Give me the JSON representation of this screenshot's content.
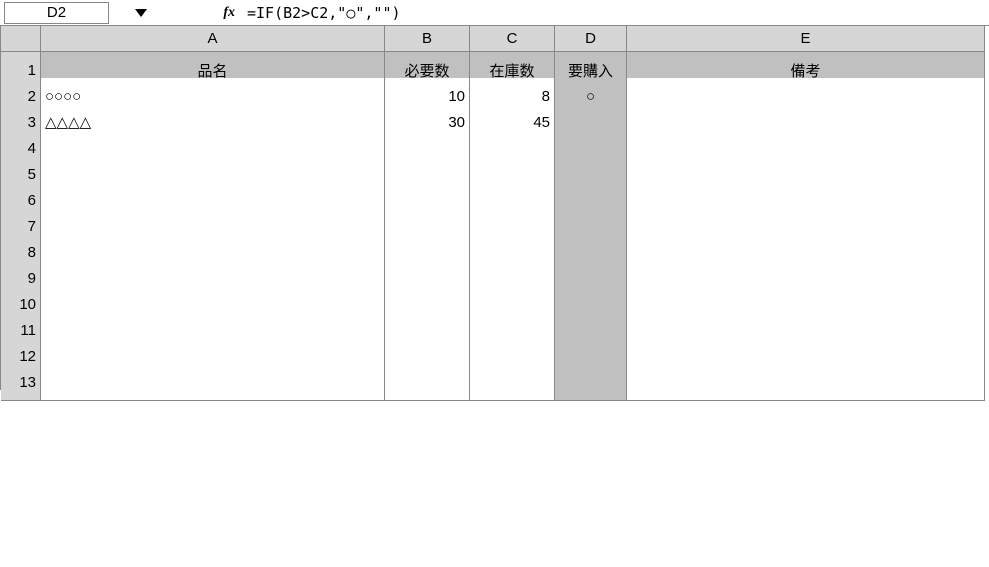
{
  "name_box": "D2",
  "fx_label": "fx",
  "formula": "=IF(B2>C2,\"○\",\"\")",
  "columns": [
    "A",
    "B",
    "C",
    "D",
    "E"
  ],
  "rows": [
    "1",
    "2",
    "3",
    "4",
    "5",
    "6",
    "7",
    "8",
    "9",
    "10",
    "11",
    "12",
    "13"
  ],
  "headers": {
    "A": "品名",
    "B": "必要数",
    "C": "在庫数",
    "D": "要購入",
    "E": "備考"
  },
  "data": [
    {
      "A": "○○○○",
      "B": "10",
      "C": "8",
      "D": "○",
      "E": ""
    },
    {
      "A": "△△△△",
      "B": "30",
      "C": "45",
      "D": "",
      "E": ""
    },
    {
      "A": "",
      "B": "",
      "C": "",
      "D": "",
      "E": ""
    },
    {
      "A": "",
      "B": "",
      "C": "",
      "D": "",
      "E": ""
    },
    {
      "A": "",
      "B": "",
      "C": "",
      "D": "",
      "E": ""
    },
    {
      "A": "",
      "B": "",
      "C": "",
      "D": "",
      "E": ""
    },
    {
      "A": "",
      "B": "",
      "C": "",
      "D": "",
      "E": ""
    },
    {
      "A": "",
      "B": "",
      "C": "",
      "D": "",
      "E": ""
    },
    {
      "A": "",
      "B": "",
      "C": "",
      "D": "",
      "E": ""
    },
    {
      "A": "",
      "B": "",
      "C": "",
      "D": "",
      "E": ""
    },
    {
      "A": "",
      "B": "",
      "C": "",
      "D": "",
      "E": ""
    },
    {
      "A": "",
      "B": "",
      "C": "",
      "D": "",
      "E": ""
    }
  ]
}
